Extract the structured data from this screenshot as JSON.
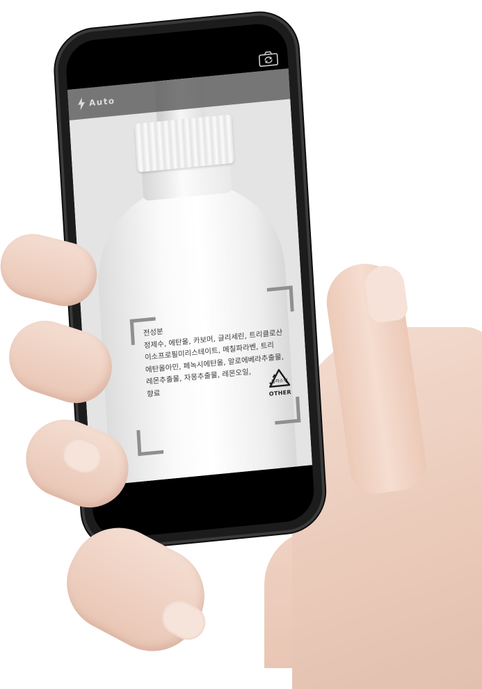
{
  "camera": {
    "flash_label": "Auto",
    "flash_icon": "lightning-bolt-icon",
    "switch_icon": "camera-switch-icon"
  },
  "label": {
    "heading": "전성분",
    "lines": [
      "정제수, 에탄올, 카보머, 글리세린, 트리클로산",
      "이소프로필미리스테이트, 메칠파라벤, 트리",
      "에탄올아민, 페녹시에탄올, 알로에베라추출물,",
      "레몬추출물, 자몽추출물, 레몬오일,",
      "향료"
    ],
    "recycle_text": "플라스틱",
    "recycle_code": "OTHER"
  },
  "colors": {
    "topbar": "#5a5a5a",
    "scan_frame": "#8f8f8f",
    "skin": "#f1d5c6",
    "phone_frame": "#1c1c1c"
  }
}
